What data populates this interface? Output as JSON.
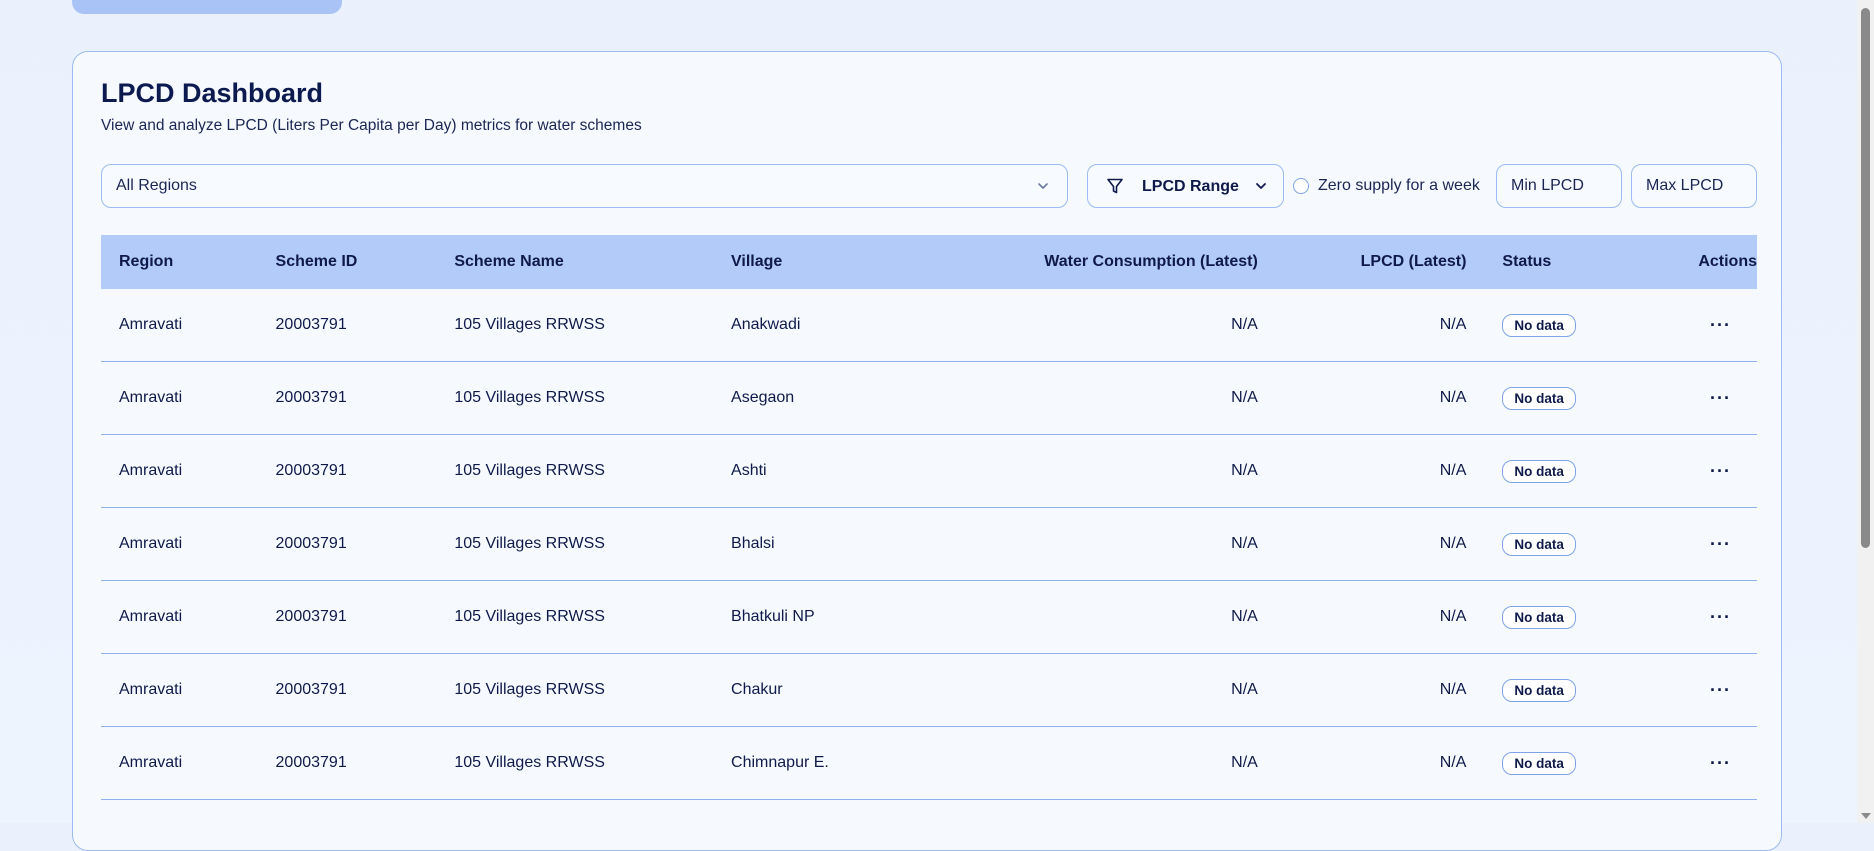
{
  "header": {
    "title": "LPCD Dashboard",
    "subtitle": "View and analyze LPCD (Liters Per Capita per Day) metrics for water schemes"
  },
  "filters": {
    "region_value": "All Regions",
    "range_label": "LPCD Range",
    "zero_supply_label": "Zero supply for a week",
    "min_placeholder": "Min LPCD",
    "max_placeholder": "Max LPCD"
  },
  "table": {
    "columns": [
      "Region",
      "Scheme ID",
      "Scheme Name",
      "Village",
      "Water Consumption (Latest)",
      "LPCD (Latest)",
      "Status",
      "Actions"
    ],
    "rows": [
      {
        "region": "Amravati",
        "scheme_id": "20003791",
        "scheme_name": "105 Villages RRWSS",
        "village": "Anakwadi",
        "water": "N/A",
        "lpcd": "N/A",
        "status": "No data",
        "actions": "···"
      },
      {
        "region": "Amravati",
        "scheme_id": "20003791",
        "scheme_name": "105 Villages RRWSS",
        "village": "Asegaon",
        "water": "N/A",
        "lpcd": "N/A",
        "status": "No data",
        "actions": "···"
      },
      {
        "region": "Amravati",
        "scheme_id": "20003791",
        "scheme_name": "105 Villages RRWSS",
        "village": "Ashti",
        "water": "N/A",
        "lpcd": "N/A",
        "status": "No data",
        "actions": "···"
      },
      {
        "region": "Amravati",
        "scheme_id": "20003791",
        "scheme_name": "105 Villages RRWSS",
        "village": "Bhalsi",
        "water": "N/A",
        "lpcd": "N/A",
        "status": "No data",
        "actions": "···"
      },
      {
        "region": "Amravati",
        "scheme_id": "20003791",
        "scheme_name": "105 Villages RRWSS",
        "village": "Bhatkuli NP",
        "water": "N/A",
        "lpcd": "N/A",
        "status": "No data",
        "actions": "···"
      },
      {
        "region": "Amravati",
        "scheme_id": "20003791",
        "scheme_name": "105 Villages RRWSS",
        "village": "Chakur",
        "water": "N/A",
        "lpcd": "N/A",
        "status": "No data",
        "actions": "···"
      },
      {
        "region": "Amravati",
        "scheme_id": "20003791",
        "scheme_name": "105 Villages RRWSS",
        "village": "Chimnapur E.",
        "water": "N/A",
        "lpcd": "N/A",
        "status": "No data",
        "actions": "···"
      }
    ]
  },
  "icons": {
    "filter": "filter-icon",
    "chevron": "chevron-down-icon",
    "more": "more-horizontal-icon"
  },
  "colors": {
    "accent": "#b3cbf9",
    "border": "#9dbbf0",
    "text": "#0f1a4a",
    "background": "#eef4fe"
  }
}
